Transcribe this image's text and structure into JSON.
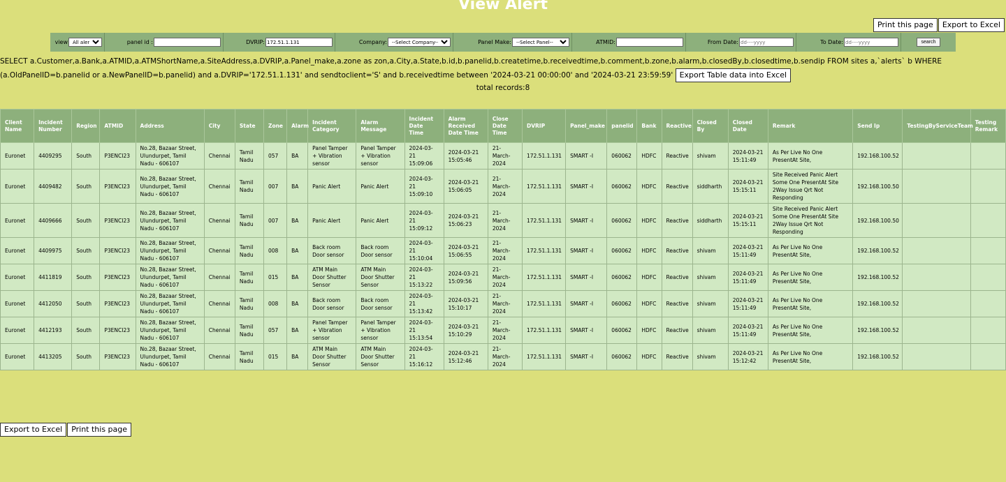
{
  "page": {
    "title": "View Alert"
  },
  "top_actions": {
    "print": "Print this page",
    "export": "Export to Excel"
  },
  "filters": {
    "view_label": "view",
    "view_value": "All alert",
    "panel_id_label": "panel id :",
    "panel_id_value": "",
    "dvrip_label": "DVRIP:",
    "dvrip_value": "172.51.1.131",
    "company_label": "Company:",
    "company_value": "--Select Company--",
    "panel_make_label": "Panel Make:",
    "panel_make_value": "--Select Panel--",
    "atmid_label": "ATMID:",
    "atmid_value": "",
    "from_date_label": "From Date:",
    "from_date_placeholder": "dd----yyyy",
    "to_date_label": "To Date:",
    "to_date_placeholder": "dd----yyyy",
    "search_label": "search"
  },
  "sql": {
    "text": "SELECT a.Customer,a.Bank,a.ATMID,a.ATMShortName,a.SiteAddress,a.DVRIP,a.Panel_make,a.zone as zon,a.City,a.State,b.id,b.panelid,b.createtime,b.receivedtime,b.comment,b.zone,b.alarm,b.closedBy,b.closedtime,b.sendip FROM sites a,`alerts` b WHERE (a.OldPanelID=b.panelid or a.NewPanelID=b.panelid) and a.DVRIP='172.51.1.131' and sendtoclient='S' and b.receivedtime between '2024-03-21 00:00:00' and '2024-03-21 23:59:59'",
    "export_button": "Export Table data into Excel"
  },
  "total": "total records:8",
  "table": {
    "headers": [
      "Client Name",
      "Incident Number",
      "Region",
      "ATMID",
      "Address",
      "City",
      "State",
      "Zone",
      "Alarm",
      "Incident Category",
      "Alarm Message",
      "Incident Date Time",
      "Alarm Received Date Time",
      "Close Date Time",
      "DVRIP",
      "Panel_make",
      "panelid",
      "Bank",
      "Reactive",
      "Closed By",
      "Closed Date",
      "Remark",
      "Send Ip",
      "TestingByServiceTeam",
      "Testing Remark"
    ],
    "rows": [
      [
        "Euronet",
        "4409295",
        "South",
        "P3ENCI23",
        "No.28, Bazaar Street, Ulundurpet, Tamil Nadu - 606107",
        "Chennai",
        "Tamil Nadu",
        "057",
        "BA",
        "Panel Tamper + Vibration sensor",
        "Panel Tamper + Vibration sensor",
        "2024-03-21 15:09:06",
        "2024-03-21 15:05:46",
        "21-March-2024",
        "172.51.1.131",
        "SMART -I",
        "060062",
        "HDFC",
        "Reactive",
        "shivam",
        "2024-03-21 15:11:49",
        "As Per Live No One PresentAt Site,",
        "192.168.100.52",
        "",
        ""
      ],
      [
        "Euronet",
        "4409482",
        "South",
        "P3ENCI23",
        "No.28, Bazaar Street, Ulundurpet, Tamil Nadu - 606107",
        "Chennai",
        "Tamil Nadu",
        "007",
        "BA",
        "Panic Alert",
        "Panic Alert",
        "2024-03-21 15:09:10",
        "2024-03-21 15:06:05",
        "21-March-2024",
        "172.51.1.131",
        "SMART -I",
        "060062",
        "HDFC",
        "Reactive",
        "siddharth",
        "2024-03-21 15:15:11",
        "Site Received Panic Alert Some One PresentAt Site 2Way Issue Qrt Not Responding",
        "192.168.100.50",
        "",
        ""
      ],
      [
        "Euronet",
        "4409666",
        "South",
        "P3ENCI23",
        "No.28, Bazaar Street, Ulundurpet, Tamil Nadu - 606107",
        "Chennai",
        "Tamil Nadu",
        "007",
        "BA",
        "Panic Alert",
        "Panic Alert",
        "2024-03-21 15:09:12",
        "2024-03-21 15:06:23",
        "21-March-2024",
        "172.51.1.131",
        "SMART -I",
        "060062",
        "HDFC",
        "Reactive",
        "siddharth",
        "2024-03-21 15:15:11",
        "Site Received Panic Alert Some One PresentAt Site 2Way Issue Qrt Not Responding",
        "192.168.100.50",
        "",
        ""
      ],
      [
        "Euronet",
        "4409975",
        "South",
        "P3ENCI23",
        "No.28, Bazaar Street, Ulundurpet, Tamil Nadu - 606107",
        "Chennai",
        "Tamil Nadu",
        "008",
        "BA",
        "Back room Door sensor",
        "Back room Door sensor",
        "2024-03-21 15:10:04",
        "2024-03-21 15:06:55",
        "21-March-2024",
        "172.51.1.131",
        "SMART -I",
        "060062",
        "HDFC",
        "Reactive",
        "shivam",
        "2024-03-21 15:11:49",
        "As Per Live No One PresentAt Site,",
        "192.168.100.52",
        "",
        ""
      ],
      [
        "Euronet",
        "4411819",
        "South",
        "P3ENCI23",
        "No.28, Bazaar Street, Ulundurpet, Tamil Nadu - 606107",
        "Chennai",
        "Tamil Nadu",
        "015",
        "BA",
        "ATM Main Door Shutter Sensor",
        "ATM Main Door Shutter Sensor",
        "2024-03-21 15:13:22",
        "2024-03-21 15:09:56",
        "21-March-2024",
        "172.51.1.131",
        "SMART -I",
        "060062",
        "HDFC",
        "Reactive",
        "shivam",
        "2024-03-21 15:11:49",
        "As Per Live No One PresentAt Site,",
        "192.168.100.52",
        "",
        ""
      ],
      [
        "Euronet",
        "4412050",
        "South",
        "P3ENCI23",
        "No.28, Bazaar Street, Ulundurpet, Tamil Nadu - 606107",
        "Chennai",
        "Tamil Nadu",
        "008",
        "BA",
        "Back room Door sensor",
        "Back room Door sensor",
        "2024-03-21 15:13:42",
        "2024-03-21 15:10:17",
        "21-March-2024",
        "172.51.1.131",
        "SMART -I",
        "060062",
        "HDFC",
        "Reactive",
        "shivam",
        "2024-03-21 15:11:49",
        "As Per Live No One PresentAt Site,",
        "192.168.100.52",
        "",
        ""
      ],
      [
        "Euronet",
        "4412193",
        "South",
        "P3ENCI23",
        "No.28, Bazaar Street, Ulundurpet, Tamil Nadu - 606107",
        "Chennai",
        "Tamil Nadu",
        "057",
        "BA",
        "Panel Tamper + Vibration sensor",
        "Panel Tamper + Vibration sensor",
        "2024-03-21 15:13:54",
        "2024-03-21 15:10:29",
        "21-March-2024",
        "172.51.1.131",
        "SMART -I",
        "060062",
        "HDFC",
        "Reactive",
        "shivam",
        "2024-03-21 15:11:49",
        "As Per Live No One PresentAt Site,",
        "192.168.100.52",
        "",
        ""
      ],
      [
        "Euronet",
        "4413205",
        "South",
        "P3ENCI23",
        "No.28, Bazaar Street, Ulundurpet, Tamil Nadu - 606107",
        "Chennai",
        "Tamil Nadu",
        "015",
        "BA",
        "ATM Main Door Shutter Sensor",
        "ATM Main Door Shutter Sensor",
        "2024-03-21 15:16:12",
        "2024-03-21 15:12:46",
        "21-March-2024",
        "172.51.1.131",
        "SMART -I",
        "060062",
        "HDFC",
        "Reactive",
        "shivam",
        "2024-03-21 15:12:42",
        "As Per Live No One PresentAt Site,",
        "192.168.100.52",
        "",
        ""
      ]
    ]
  },
  "bottom_actions": {
    "export": "Export to Excel",
    "print": "Print this page"
  }
}
